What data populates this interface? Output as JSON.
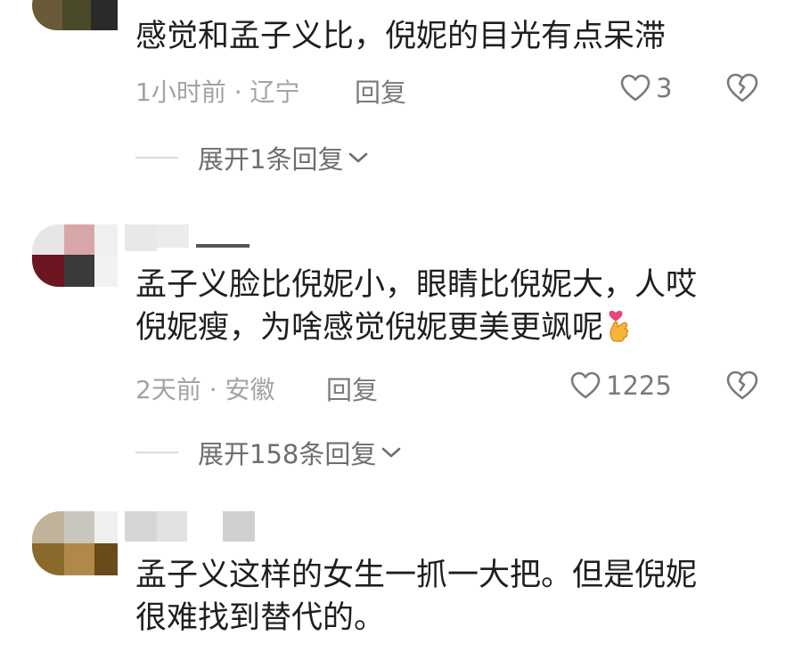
{
  "comments": [
    {
      "text_lines": [
        "感觉和孟子义比，倪妮的目光有点呆滞"
      ],
      "time": "1小时前",
      "location": "辽宁",
      "separator": "·",
      "reply_label": "回复",
      "likes": "3",
      "expand_label": "展开1条回复"
    },
    {
      "text_lines": [
        "孟子义脸比倪妮小，眼睛比倪妮大，人哎",
        "倪妮瘦，为啥感觉倪妮更美更飒呢"
      ],
      "emoji": "finger-heart-emoji",
      "time": "2天前",
      "location": "安徽",
      "separator": "·",
      "reply_label": "回复",
      "likes": "1225",
      "expand_label": "展开158条回复"
    },
    {
      "text_lines": [
        "孟子义这样的女生一抓一大把。但是倪妮",
        "很难找到替代的。"
      ]
    }
  ],
  "icons": {
    "like": "heart-outline-icon",
    "dislike": "broken-heart-icon",
    "expand": "chevron-down-icon"
  },
  "colors": {
    "text": "#1f1f1f",
    "meta": "#a3a3a3",
    "action": "#7a7a7a",
    "divider": "#dcdcdc"
  }
}
